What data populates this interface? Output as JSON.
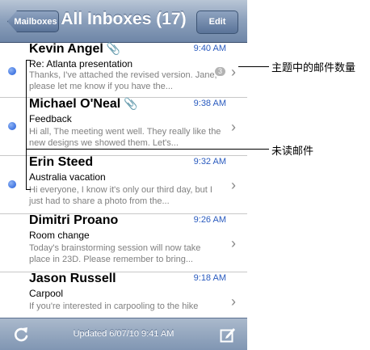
{
  "navbar": {
    "back_label": "Mailboxes",
    "title": "All Inboxes (17)",
    "edit_label": "Edit"
  },
  "messages": [
    {
      "sender": "Kevin Angel",
      "attachment": true,
      "time": "9:40 AM",
      "subject": "Re: Atlanta presentation",
      "preview": "Thanks, I've attached the revised version. Jane, please let me know if you have the...",
      "unread": true,
      "thread_count": "3"
    },
    {
      "sender": "Michael O'Neal",
      "attachment": true,
      "time": "9:38 AM",
      "subject": "Feedback",
      "preview": "Hi all, The meeting went well. They really like the new designs we showed them. Let's...",
      "unread": true
    },
    {
      "sender": "Erin Steed",
      "attachment": false,
      "time": "9:32 AM",
      "subject": "Australia vacation",
      "preview": "Hi everyone, I know it's only our third day, but I just had to share a photo from the...",
      "unread": true
    },
    {
      "sender": "Dimitri Proano",
      "attachment": false,
      "time": "9:26 AM",
      "subject": "Room change",
      "preview": "Today's brainstorming session will now take place in 23D. Please remember to bring...",
      "unread": false
    },
    {
      "sender": "Jason Russell",
      "attachment": false,
      "time": "9:18 AM",
      "subject": "Carpool",
      "preview": "If you're interested in carpooling to the hike",
      "unread": false
    }
  ],
  "toolbar": {
    "updated_text": "Updated 6/07/10 9:41 AM"
  },
  "annotations": {
    "thread_count_label": "主题中的邮件数量",
    "unread_label": "未读邮件"
  },
  "icons": {
    "attachment": "paperclip-icon",
    "refresh": "refresh-icon",
    "compose": "compose-icon",
    "chevron": "chevron-right-icon"
  },
  "colors": {
    "unread_dot": "#1f5ad8",
    "time_text": "#2a5bbf",
    "navbar": "#6e86a7"
  }
}
